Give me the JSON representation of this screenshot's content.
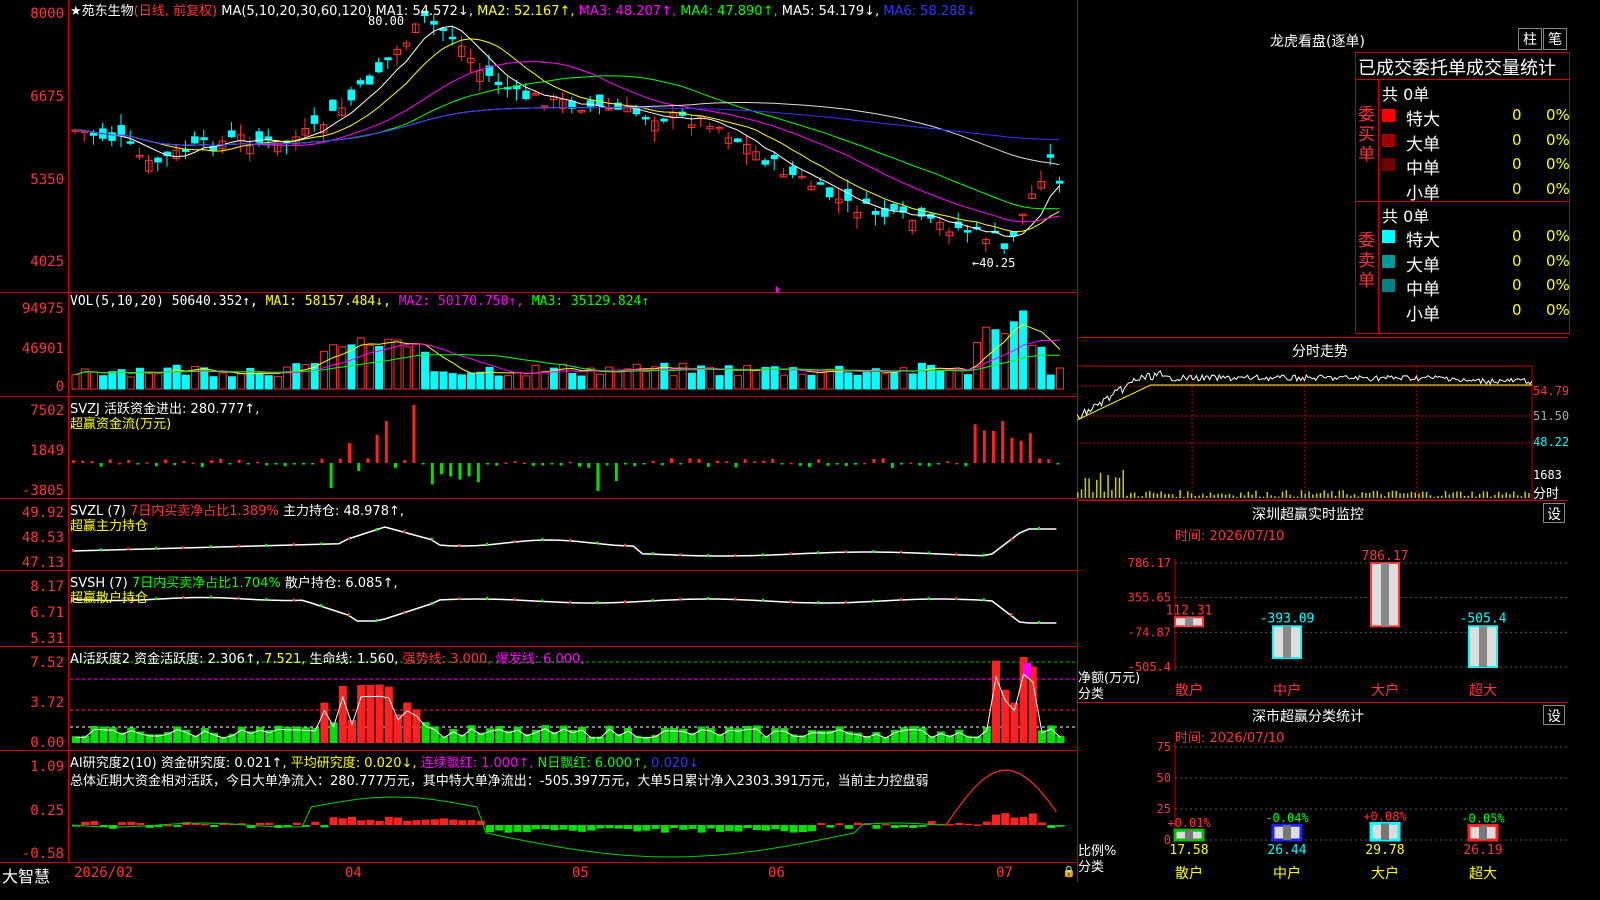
{
  "main": {
    "title_prefix": "★",
    "stock_name": "苑东生物",
    "period": "(日线, 前复权)",
    "ma_label": "MA(5,10,20,30,60,120)",
    "ma1": "MA1: 54.572↓,",
    "ma2": "MA2: 52.167↑,",
    "ma3": "MA3: 48.207↑,",
    "ma4": "MA4: 47.890↑,",
    "ma5": "MA5: 54.179↓,",
    "ma6": "MA6: 58.288↓",
    "price_axis": [
      "8000",
      "6675",
      "5350",
      "4025"
    ],
    "high_marker": "80.00",
    "low_marker": "←40.25",
    "date_axis": [
      "2026/02",
      "04",
      "05",
      "06",
      "07"
    ]
  },
  "vol": {
    "label": "VOL(5,10,20)",
    "value": "50640.352↑,",
    "ma1": "MA1: 58157.484↓,",
    "ma2": "MA2: 50170.750↑,",
    "ma3": "MA3: 35129.824↑",
    "axis": [
      "94975",
      "46901",
      "0"
    ]
  },
  "svzj": {
    "label": "SVZJ",
    "value": "活跃资金进出: 280.777↑,",
    "subtitle": "超赢资金流(万元)",
    "axis": [
      "7502",
      "1849",
      "-3805"
    ]
  },
  "svzl": {
    "label": "SVZL (7)",
    "desc": "7日内买卖净占比1.389%",
    "value": "主力持仓: 48.978↑,",
    "subtitle": "超赢主力持仓",
    "axis": [
      "49.92",
      "48.53",
      "47.13"
    ]
  },
  "svsh": {
    "label": "SVSH (7)",
    "desc": "7日内买卖净占比1.704%",
    "value": "散户持仓: 6.085↑,",
    "subtitle": "超赢散户持仓",
    "axis": [
      "8.17",
      "6.71",
      "5.31"
    ]
  },
  "ai1": {
    "label": "AI活跃度2",
    "v1": "资金活跃度: 2.306↑,",
    "v2": "7.521,",
    "v3": "生命线: 1.560,",
    "v4": "强势线: 3.000,",
    "v5": "爆发线: 6.000,",
    "axis": [
      "7.52",
      "3.72",
      "0.00"
    ]
  },
  "ai2": {
    "label": "AI研究度2(10)",
    "v1": "资金研究度: 0.021↑,",
    "v2": "平均研究度: 0.020↓,",
    "v3": "连续飘红: 1.000↑,",
    "v4": "N日飘红: 6.000↑,",
    "v5": "0.020↓",
    "summary": "总体近期大资金相对活跃，今日大单净流入：280.777万元，其中特大单净流出：-505.397万元，大单5日累计净入2303.391万元，当前主力控盘弱",
    "axis": [
      "1.09",
      "0.25",
      "-0.58"
    ]
  },
  "footer": {
    "brand": "大智慧"
  },
  "right": {
    "lhb_title": "龙虎看盘(逐单)",
    "btn_zhu": "柱",
    "btn_bi": "笔",
    "stat_title": "已成交委托单成交量统计",
    "buy_side": "委买单",
    "sell_side": "委卖单",
    "buy_total": "共 0单",
    "sell_total": "共 0单",
    "buy_rows": [
      {
        "name": "特大",
        "count": "0",
        "pct": "0%",
        "color": "#ff0000"
      },
      {
        "name": "大单",
        "count": "0",
        "pct": "0%",
        "color": "#a00000"
      },
      {
        "name": "中单",
        "count": "0",
        "pct": "0%",
        "color": "#700000"
      },
      {
        "name": "小单",
        "count": "0",
        "pct": "0%",
        "color": "#000000"
      }
    ],
    "sell_rows": [
      {
        "name": "特大",
        "count": "0",
        "pct": "0%",
        "color": "#00ffff"
      },
      {
        "name": "大单",
        "count": "0",
        "pct": "0%",
        "color": "#009999"
      },
      {
        "name": "中单",
        "count": "0",
        "pct": "0%",
        "color": "#008080"
      },
      {
        "name": "小单",
        "count": "0",
        "pct": "0%",
        "color": "#000000"
      }
    ],
    "intraday_title": "分时走势",
    "intraday_axis": [
      "54.79",
      "51.50",
      "48.22"
    ],
    "intraday_vol": "1683",
    "intraday_vol_label": "分时",
    "monitor_title": "深圳超赢实时监控",
    "monitor_btn": "设",
    "monitor_date": "时间: 2026/07/10",
    "monitor_axis": [
      "786.17",
      "355.65",
      "-74.87",
      "-505.4"
    ],
    "monitor_ylabel": "净额(万元)",
    "monitor_xlabel": "分类",
    "classify_title": "深市超赢分类统计",
    "classify_btn": "设",
    "classify_date": "时间: 2026/07/10",
    "classify_axis": [
      "75",
      "50",
      "25",
      "0"
    ],
    "classify_ylabel": "比例%",
    "classify_xlabel": "分类"
  },
  "chart_data": [
    {
      "type": "bar",
      "title": "深圳超赢实时监控",
      "categories": [
        "散户",
        "中户",
        "大户",
        "超大"
      ],
      "values": [
        112.31,
        -393.09,
        786.17,
        -505.4
      ],
      "value_labels": [
        "112.31",
        "-393.09",
        "786.17",
        "-505.4"
      ],
      "ylim": [
        -505.4,
        786.17
      ],
      "colors": [
        "#ff3333",
        "#00ffff",
        "#ff3333",
        "#00ffff"
      ]
    },
    {
      "type": "bar",
      "title": "深市超赢分类统计",
      "categories": [
        "散户",
        "中户",
        "大户",
        "超大"
      ],
      "values": [
        17.58,
        26.44,
        29.78,
        26.19
      ],
      "value_labels": [
        "17.58",
        "26.44",
        "29.78",
        "26.19"
      ],
      "changes": [
        "+0.01%",
        "-0.04%",
        "+0.08%",
        "-0.05%"
      ],
      "ylim": [
        0,
        75
      ]
    }
  ]
}
